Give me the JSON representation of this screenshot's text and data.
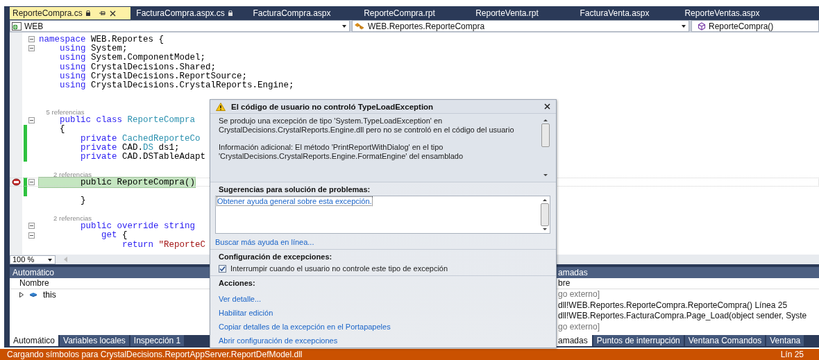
{
  "tabs": [
    {
      "label": "ReporteCompra.cs",
      "selected": true,
      "locked": true
    },
    {
      "label": "FacturaCompra.aspx.cs",
      "selected": false,
      "locked": true
    },
    {
      "label": "FacturaCompra.aspx",
      "selected": false,
      "locked": false
    },
    {
      "label": "ReporteCompra.rpt",
      "selected": false,
      "locked": false
    },
    {
      "label": "ReporteVenta.rpt",
      "selected": false,
      "locked": false
    },
    {
      "label": "FacturaVenta.aspx",
      "selected": false,
      "locked": false
    },
    {
      "label": "ReporteVentas.aspx",
      "selected": false,
      "locked": false
    }
  ],
  "nav_bar": {
    "project": "WEB",
    "type": "WEB.Reportes.ReporteCompra",
    "member": "ReporteCompra()"
  },
  "code_lines": [
    {
      "kind": "code",
      "fold": true,
      "changed": false,
      "current": false,
      "tokens": [
        {
          "t": "namespace",
          "kind": "keyword"
        },
        {
          "t": " WEB.Reportes {",
          "kind": "plain"
        }
      ]
    },
    {
      "kind": "code",
      "fold": true,
      "changed": false,
      "current": false,
      "tokens": [
        {
          "t": "    using",
          "kind": "keyword"
        },
        {
          "t": " System;",
          "kind": "plain"
        }
      ]
    },
    {
      "kind": "code",
      "fold": false,
      "changed": false,
      "current": false,
      "tokens": [
        {
          "t": "    using",
          "kind": "keyword"
        },
        {
          "t": " System.ComponentModel;",
          "kind": "plain"
        }
      ]
    },
    {
      "kind": "code",
      "fold": false,
      "changed": false,
      "current": false,
      "tokens": [
        {
          "t": "    using",
          "kind": "keyword"
        },
        {
          "t": " CrystalDecisions.Shared;",
          "kind": "plain"
        }
      ]
    },
    {
      "kind": "code",
      "fold": false,
      "changed": false,
      "current": false,
      "tokens": [
        {
          "t": "    using",
          "kind": "keyword"
        },
        {
          "t": " CrystalDecisions.ReportSource;",
          "kind": "plain"
        }
      ]
    },
    {
      "kind": "code",
      "fold": false,
      "changed": false,
      "current": false,
      "tokens": [
        {
          "t": "    using",
          "kind": "keyword"
        },
        {
          "t": " CrystalDecisions.CrystalReports.Engine;",
          "kind": "plain"
        }
      ]
    },
    {
      "kind": "blank",
      "changed": false
    },
    {
      "kind": "blank",
      "changed": false
    },
    {
      "kind": "lens",
      "text": "    5 referencias"
    },
    {
      "kind": "code",
      "fold": true,
      "changed": false,
      "current": false,
      "tokens": [
        {
          "t": "    public class",
          "kind": "keyword"
        },
        {
          "t": " ReporteCompra",
          "kind": "type"
        }
      ]
    },
    {
      "kind": "code",
      "fold": false,
      "changed": true,
      "current": false,
      "tokens": [
        {
          "t": "    {",
          "kind": "plain"
        }
      ]
    },
    {
      "kind": "code",
      "fold": false,
      "changed": true,
      "current": false,
      "tokens": [
        {
          "t": "        private",
          "kind": "keyword"
        },
        {
          "t": " CachedReporteCo",
          "kind": "type"
        }
      ]
    },
    {
      "kind": "code",
      "fold": false,
      "changed": true,
      "current": false,
      "tokens": [
        {
          "t": "        private",
          "kind": "keyword"
        },
        {
          "t": " CAD.",
          "kind": "plain"
        },
        {
          "t": "DS",
          "kind": "type"
        },
        {
          "t": " ds1;",
          "kind": "plain"
        }
      ]
    },
    {
      "kind": "code",
      "fold": false,
      "changed": true,
      "current": false,
      "tokens": [
        {
          "t": "        private",
          "kind": "keyword"
        },
        {
          "t": " CAD.DSTableAdapt",
          "kind": "plain"
        }
      ]
    },
    {
      "kind": "blank",
      "changed": false
    },
    {
      "kind": "lens",
      "text": "        2 referencias"
    },
    {
      "kind": "code",
      "fold": true,
      "changed": true,
      "current": true,
      "tokens": [
        {
          "t": "        public ReporteCompra()",
          "kind": "plain",
          "highlighted": true
        }
      ]
    },
    {
      "kind": "blank",
      "changed": true
    },
    {
      "kind": "code",
      "fold": false,
      "changed": false,
      "current": false,
      "tokens": [
        {
          "t": "        }",
          "kind": "plain"
        }
      ]
    },
    {
      "kind": "blank",
      "changed": false
    },
    {
      "kind": "lens",
      "text": "        2 referencias"
    },
    {
      "kind": "code",
      "fold": true,
      "changed": false,
      "current": false,
      "tokens": [
        {
          "t": "        public override string",
          "kind": "keyword"
        }
      ]
    },
    {
      "kind": "code",
      "fold": true,
      "changed": false,
      "current": false,
      "tokens": [
        {
          "t": "            get",
          "kind": "keyword"
        },
        {
          "t": " {",
          "kind": "plain"
        }
      ]
    },
    {
      "kind": "code",
      "fold": false,
      "changed": false,
      "current": false,
      "tokens": [
        {
          "t": "                return",
          "kind": "keyword"
        },
        {
          "t": " \"ReporteC",
          "kind": "string"
        }
      ]
    }
  ],
  "zoom": "100 %",
  "exception_popup": {
    "title": "El código de usuario no controló TypeLoadException",
    "message": [
      "Se produjo una excepción de tipo 'System.TypeLoadException' en CrystalDecisions.CrystalReports.Engine.dll pero no se controló en el código del usuario",
      "Información adicional: El método 'PrintReportWithDialog' en el tipo 'CrystalDecisions.CrystalReports.Engine.FormatEngine' del ensamblado"
    ],
    "suggestions_heading": "Sugerencias para solución de problemas:",
    "suggestions": [
      "Obtener ayuda general sobre esta excepción."
    ],
    "more_help_link": "Buscar más ayuda en línea...",
    "settings_heading": "Configuración de excepciones:",
    "break_option": {
      "label": "Interrumpir cuando el usuario no controle este tipo de excepción",
      "checked": true
    },
    "actions_heading": "Acciones:",
    "actions": [
      "Ver detalle...",
      "Habilitar edición",
      "Copiar detalles de la excepción en el Portapapeles",
      "Abrir configuración de excepciones"
    ]
  },
  "autos_panel": {
    "title": "Automático",
    "column": "Nombre",
    "rows": [
      "this"
    ],
    "tabs": [
      {
        "label": "Automático",
        "selected": true
      },
      {
        "label": "Variables locales",
        "selected": false
      },
      {
        "label": "Inspección 1",
        "selected": false
      }
    ]
  },
  "call_stack_panel": {
    "title": "amadas",
    "column": "bre",
    "rows": [
      {
        "text": "go externo]",
        "external": true
      },
      {
        "text": "dll!WEB.Reportes.ReporteCompra.ReporteCompra() Línea 25",
        "external": false
      },
      {
        "text": "dll!WEB.Reportes.FacturaCompra.Page_Load(object sender, Syste",
        "external": false
      },
      {
        "text": "go externo]",
        "external": true
      }
    ],
    "tabs": [
      {
        "label": "amadas",
        "selected": true
      },
      {
        "label": "Puntos de interrupción",
        "selected": false
      },
      {
        "label": "Ventana Comandos",
        "selected": false
      },
      {
        "label": "Ventana",
        "selected": false
      }
    ]
  },
  "status_bar": {
    "message": "Cargando símbolos para CrystalDecisions.ReportAppServer.ReportDefModel.dll",
    "position": "Lín 25"
  }
}
